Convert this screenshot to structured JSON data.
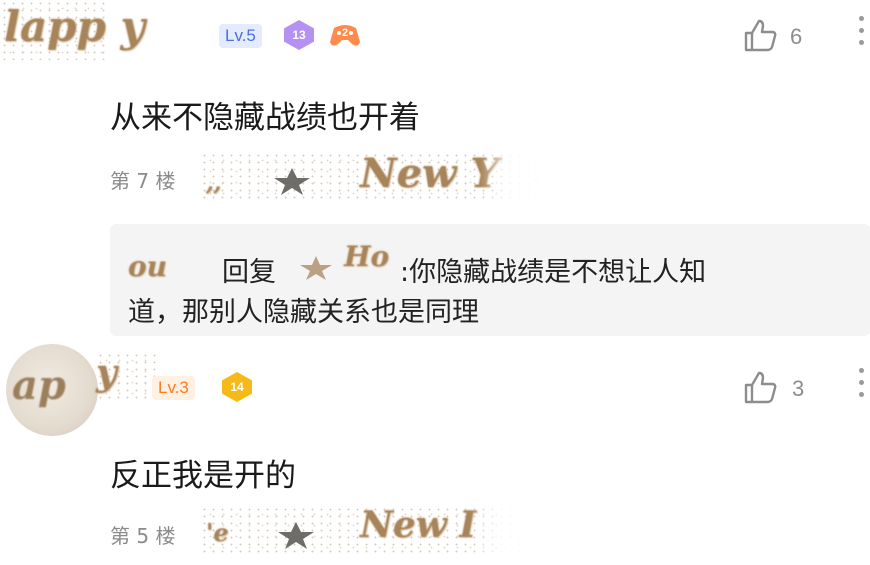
{
  "comments": [
    {
      "level": "Lv.5",
      "badge_fans": "13",
      "badge_game": "2",
      "likes": "6",
      "text": "从来不隐藏战绩也开着",
      "floor": "第 7 楼",
      "reply": {
        "prefix": "回复",
        "line1": ":你隐藏战绩是不想让人知",
        "line2": "道，那别人隐藏关系也是同理"
      }
    },
    {
      "level": "Lv.3",
      "badge_fans": "14",
      "likes": "3",
      "text": "反正我是开的",
      "floor": "第 5 楼"
    }
  ],
  "colors": {
    "level_blue": "#4a6fe0",
    "level_orange": "#ff7a1f",
    "badge_purple": "#b592f2",
    "badge_gold": "#f6b91a",
    "badge_game": "#ff8a4c",
    "reply_bg": "#f4f4f4"
  }
}
